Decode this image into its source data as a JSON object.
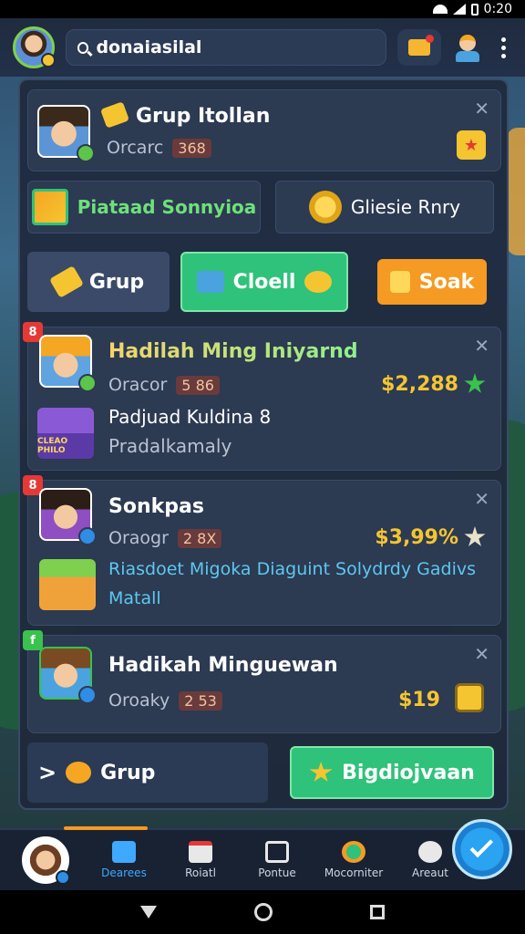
{
  "status_bar": {
    "time": "0:20"
  },
  "search": {
    "value": "donaiasilal"
  },
  "profile_card": {
    "title": "Grup Itollan",
    "meta_label": "Orcarc",
    "meta_value": "368"
  },
  "quick_actions": [
    {
      "label": "Piataad Sonnyioa"
    },
    {
      "label": "Gliesie Rnry"
    }
  ],
  "tabs": [
    {
      "label": "Grup"
    },
    {
      "label": "Cloell"
    },
    {
      "label": "Soak"
    }
  ],
  "list_items": [
    {
      "title": "Hadilah Ming Iniyarnd",
      "meta_label": "Oracor",
      "meta_value": "5 86",
      "price": "$2,288",
      "line1": "Padjuad Kuldina  8",
      "line2": "Pradalkamaly",
      "box_label": "CLEAO PHILO",
      "tag": "8"
    },
    {
      "title": "Sonkpas",
      "meta_label": "Oraogr",
      "meta_value": "2 8X",
      "price": "$3,99%",
      "line1": "Riasdoet Migoka Diaguint Solydrdy Gadivs",
      "line2": "Matall",
      "tag": "8"
    },
    {
      "title": "Hadikah Minguewan",
      "meta_label": "Oroaky",
      "meta_value": "2 53",
      "price": "$19",
      "tag": "f"
    }
  ],
  "bottom_buttons": [
    {
      "label": "Grup"
    },
    {
      "label": "Bigdiojvaan"
    }
  ],
  "bottom_nav": [
    {
      "label": "Dearees",
      "active": true
    },
    {
      "label": "Roiatl"
    },
    {
      "label": "Pontue"
    },
    {
      "label": "Mocorniter"
    },
    {
      "label": "Areaut"
    }
  ],
  "colors": {
    "accent_green": "#2fc27a",
    "accent_orange": "#f59a23",
    "gold": "#f5c531",
    "panel": "#2c3a52"
  }
}
